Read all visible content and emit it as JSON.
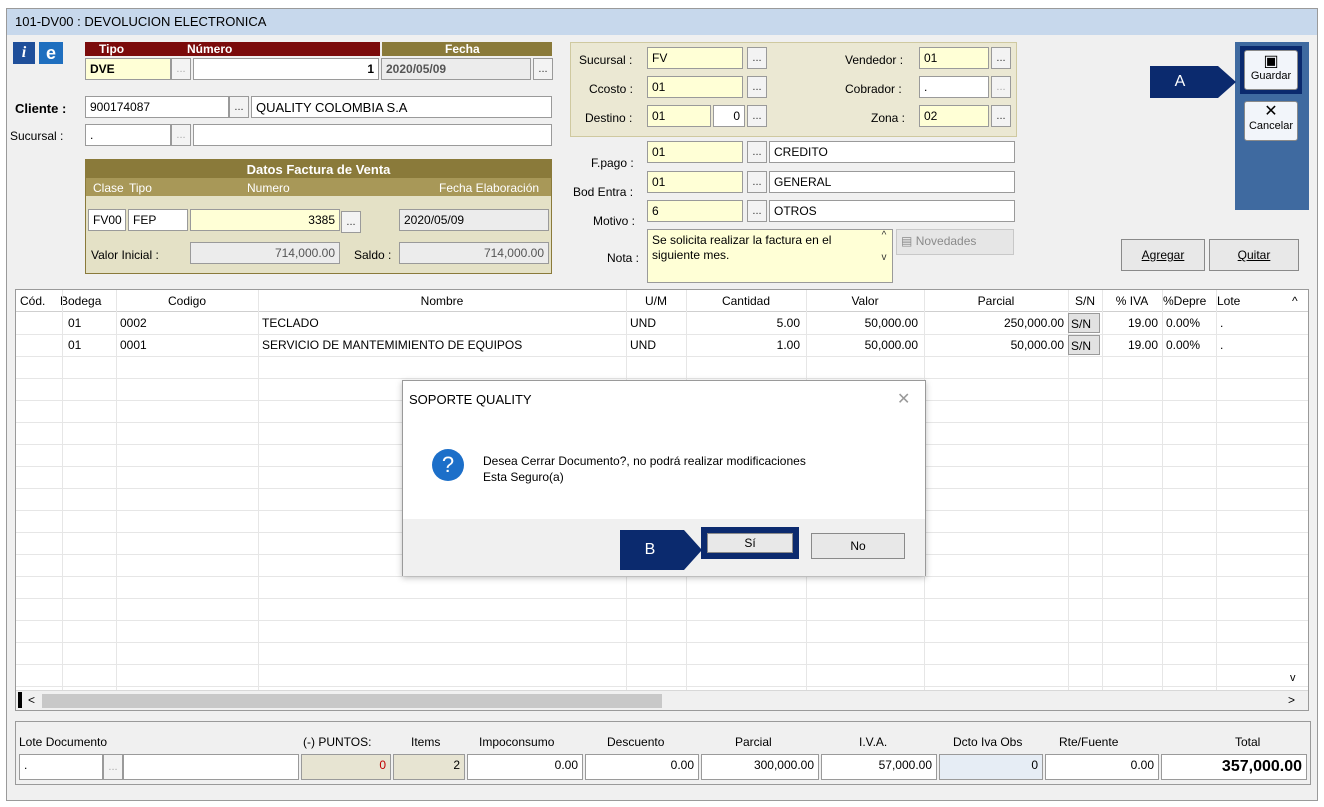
{
  "window": {
    "title": "101-DV00 : DEVOLUCION ELECTRONICA"
  },
  "header": {
    "tipo_label": "Tipo",
    "numero_label": "Número",
    "fecha_label": "Fecha",
    "tipo": "DVE",
    "numero": "1",
    "fecha": "2020/05/09",
    "cliente_label": "Cliente :",
    "cliente_code": "900174087",
    "cliente_name": "QUALITY COLOMBIA S.A",
    "sucursal_label": "Sucursal :",
    "sucursal": "."
  },
  "datos_factura": {
    "title": "Datos Factura de Venta",
    "clase_label": "Clase",
    "tipo_label": "Tipo",
    "numero_label": "Numero",
    "fecha_label": "Fecha Elaboración",
    "clase": "FV00",
    "tipo": "FEP",
    "numero": "3385",
    "fecha": "2020/05/09",
    "valor_inicial_label": "Valor Inicial :",
    "valor_inicial": "714,000.00",
    "saldo_label": "Saldo :",
    "saldo": "714,000.00"
  },
  "panel": {
    "sucursal_label": "Sucursal :",
    "sucursal": "FV",
    "ccosto_label": "Ccosto :",
    "ccosto": "01",
    "destino_label": "Destino :",
    "destino": "01",
    "destino2": "0",
    "vendedor_label": "Vendedor :",
    "vendedor": "01",
    "cobrador_label": "Cobrador :",
    "cobrador": ".",
    "zona_label": "Zona :",
    "zona": "02",
    "fpago_label": "F.pago :",
    "fpago": "01",
    "fpago_desc": "CREDITO",
    "bod_label": "Bod Entra :",
    "bod": "01",
    "bod_desc": "GENERAL",
    "motivo_label": "Motivo :",
    "motivo": "6",
    "motivo_desc": "OTROS",
    "nota_label": "Nota :",
    "nota": "Se solicita realizar la factura en el siguiente mes.",
    "novedades_label": "Novedades"
  },
  "toolbar": {
    "guardar": "Guardar",
    "cancelar": "Cancelar",
    "agregar": "Agregar",
    "quitar": "Quitar"
  },
  "grid": {
    "columns": [
      "Cód.",
      "Bodega",
      "Codigo",
      "Nombre",
      "U/M",
      "Cantidad",
      "Valor",
      "Parcial",
      "S/N",
      "% IVA",
      "%Depre",
      "Lote"
    ],
    "rows": [
      {
        "bodega": "01",
        "codigo": "0002",
        "nombre": "TECLADO",
        "um": "UND",
        "cantidad": "5.00",
        "valor": "50,000.00",
        "parcial": "250,000.00",
        "sn": "S/N",
        "iva": "19.00",
        "depre": "0.00%",
        "lote": "."
      },
      {
        "bodega": "01",
        "codigo": "0001",
        "nombre": "SERVICIO DE MANTEMIMIENTO DE EQUIPOS",
        "um": "UND",
        "cantidad": "1.00",
        "valor": "50,000.00",
        "parcial": "50,000.00",
        "sn": "S/N",
        "iva": "19.00",
        "depre": "0.00%",
        "lote": "."
      }
    ]
  },
  "footer": {
    "lote_label": "Lote Documento",
    "lote": ".",
    "puntos_label": "(-) PUNTOS:",
    "puntos": "0",
    "items_label": "Items",
    "items": "2",
    "impoconsumo_label": "Impoconsumo",
    "impoconsumo": "0.00",
    "descuento_label": "Descuento",
    "descuento": "0.00",
    "parcial_label": "Parcial",
    "parcial": "300,000.00",
    "iva_label": "I.V.A.",
    "iva": "57,000.00",
    "dcto_label": "Dcto Iva Obs",
    "dcto": "0",
    "rte_label": "Rte/Fuente",
    "rte": "0.00",
    "total_label": "Total",
    "total": "357,000.00"
  },
  "dialog": {
    "title": "SOPORTE QUALITY",
    "line1": "Desea Cerrar Documento?, no podrá realizar modificaciones",
    "line2": "Esta Seguro(a)",
    "yes": "Sí",
    "no": "No"
  },
  "annotations": {
    "a": "A",
    "b": "B"
  },
  "colors": {
    "title_bar": "#c7d8ec",
    "header_red": "#7b0b0b",
    "header_olive": "#8a7a3a",
    "side_panel": "#3f6aa0",
    "tag": "#0b2a6e"
  }
}
